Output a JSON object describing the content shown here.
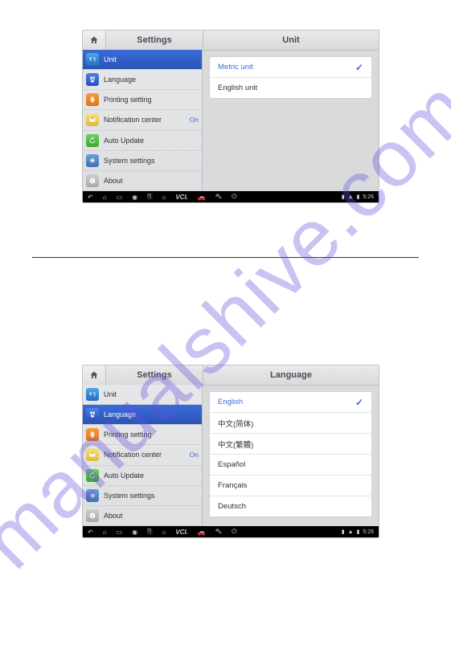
{
  "watermark": "manualshive.com",
  "header": {
    "settings_label": "Settings"
  },
  "screens": [
    {
      "title": "Unit",
      "selected_index": 0,
      "options": [
        {
          "label": "Metric unit",
          "selected": true
        },
        {
          "label": "English unit",
          "selected": false
        }
      ]
    },
    {
      "title": "Language",
      "selected_index": 1,
      "options": [
        {
          "label": "English",
          "selected": true
        },
        {
          "label": "中文(简体)",
          "selected": false
        },
        {
          "label": "中文(繁體)",
          "selected": false
        },
        {
          "label": "Español",
          "selected": false
        },
        {
          "label": "Français",
          "selected": false
        },
        {
          "label": "Deutsch",
          "selected": false
        }
      ]
    }
  ],
  "sidebar_items": [
    {
      "key": "unit",
      "label": "Unit",
      "icon": "unit-icon"
    },
    {
      "key": "language",
      "label": "Language",
      "icon": "language-icon"
    },
    {
      "key": "printing",
      "label": "Printing setting",
      "icon": "print-icon"
    },
    {
      "key": "notif",
      "label": "Notification center",
      "icon": "notification-icon",
      "right": "On"
    },
    {
      "key": "update",
      "label": "Auto Update",
      "icon": "update-icon"
    },
    {
      "key": "system",
      "label": "System settings",
      "icon": "gear-icon"
    },
    {
      "key": "about",
      "label": "About",
      "icon": "info-icon"
    }
  ],
  "navbar": {
    "icons": [
      "back-icon",
      "home-icon",
      "recent-icon",
      "globe-icon",
      "share-icon",
      "house-icon",
      "vci-label",
      "car-icon",
      "car-group-icon",
      "power-icon"
    ],
    "vci_label": "VCI.",
    "status_time": "5:26"
  }
}
